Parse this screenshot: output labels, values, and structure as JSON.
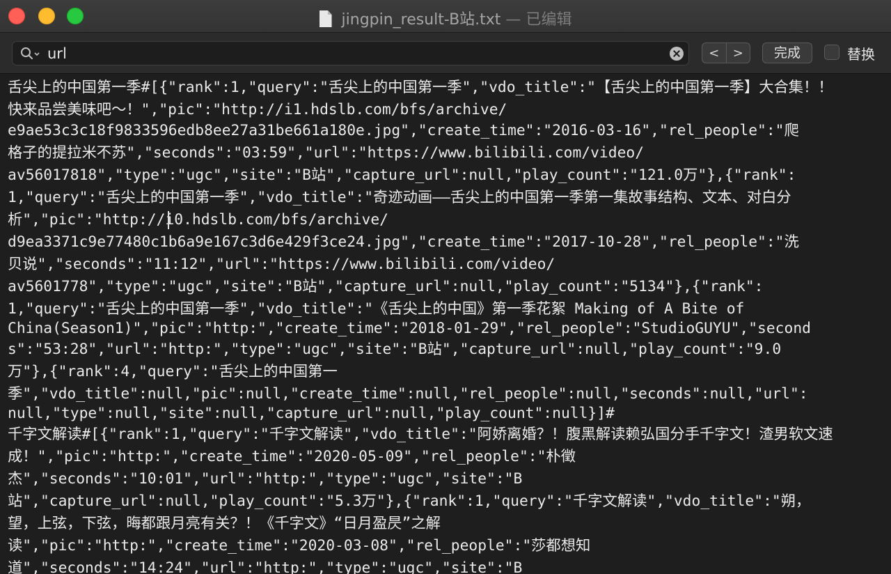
{
  "window": {
    "filename": "jingpin_result-B站.txt",
    "separator": " — ",
    "status": "已编辑"
  },
  "findbar": {
    "query": "url",
    "prev_glyph": "<",
    "next_glyph": ">",
    "done_label": "完成",
    "replace_label": "替换",
    "replace_checked": false
  },
  "editor": {
    "lines": [
      "舌尖上的中国第一季#[{\"rank\":1,\"query\":\"舌尖上的中国第一季\",\"vdo_title\":\"【舌尖上的中国第一季】大合集！！",
      "快来品尝美味吧～！\",\"pic\":\"http://i1.hdslb.com/bfs/archive/",
      "e9ae53c3c18f9833596edb8ee27a31be661a180e.jpg\",\"create_time\":\"2016-03-16\",\"rel_people\":\"爬",
      "格子的提拉米不苏\",\"seconds\":\"03:59\",\"url\":\"https://www.bilibili.com/video/",
      "av56017818\",\"type\":\"ugc\",\"site\":\"B站\",\"capture_url\":null,\"play_count\":\"121.0万\"},{\"rank\":",
      "1,\"query\":\"舌尖上的中国第一季\",\"vdo_title\":\"奇迹动画——舌尖上的中国第一季第一集故事结构、文本、对白分",
      "析\",\"pic\":\"http://i0.hdslb.com/bfs/archive/",
      "d9ea3371c9e77480c1b6a9e167c3d6e429f3ce24.jpg\",\"create_time\":\"2017-10-28\",\"rel_people\":\"洗",
      "贝说\",\"seconds\":\"11:12\",\"url\":\"https://www.bilibili.com/video/",
      "av5601778\",\"type\":\"ugc\",\"site\":\"B站\",\"capture_url\":null,\"play_count\":\"5134\"},{\"rank\":",
      "1,\"query\":\"舌尖上的中国第一季\",\"vdo_title\":\"《舌尖上的中国》第一季花絮 Making of A Bite of",
      "China(Season1)\",\"pic\":\"http:\",\"create_time\":\"2018-01-29\",\"rel_people\":\"StudioGUYU\",\"second",
      "s\":\"53:28\",\"url\":\"http:\",\"type\":\"ugc\",\"site\":\"B站\",\"capture_url\":null,\"play_count\":\"9.0",
      "万\"},{\"rank\":4,\"query\":\"舌尖上的中国第一",
      "季\",\"vdo_title\":null,\"pic\":null,\"create_time\":null,\"rel_people\":null,\"seconds\":null,\"url\":",
      "null,\"type\":null,\"site\":null,\"capture_url\":null,\"play_count\":null}]#",
      "千字文解读#[{\"rank\":1,\"query\":\"千字文解读\",\"vdo_title\":\"阿娇离婚？！腹黑解读赖弘国分手千字文！渣男软文速",
      "成！\",\"pic\":\"http:\",\"create_time\":\"2020-05-09\",\"rel_people\":\"朴徵",
      "杰\",\"seconds\":\"10:01\",\"url\":\"http:\",\"type\":\"ugc\",\"site\":\"B",
      "站\",\"capture_url\":null,\"play_count\":\"5.3万\"},{\"rank\":1,\"query\":\"千字文解读\",\"vdo_title\":\"朔，",
      "望，上弦，下弦，晦都跟月亮有关？！《千字文》“日月盈昃”之解",
      "读\",\"pic\":\"http:\",\"create_time\":\"2020-03-08\",\"rel_people\":\"莎都想知",
      "道\",\"seconds\":\"14:24\",\"url\":\"http:\",\"type\":\"ugc\",\"site\":\"B"
    ]
  }
}
